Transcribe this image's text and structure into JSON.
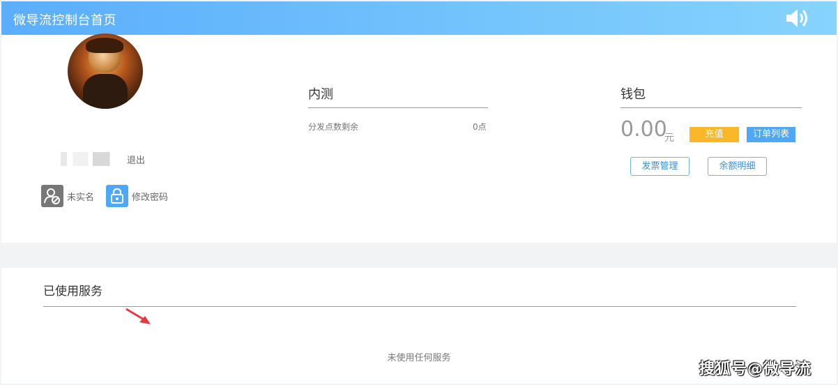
{
  "header": {
    "title": "微导流控制台首页",
    "icon": "speaker-icon"
  },
  "profile": {
    "logout": "退出",
    "realname_status": "未实名",
    "change_password": "修改密码"
  },
  "neice": {
    "title": "内测",
    "label": "分发点数剩余",
    "value": "0点"
  },
  "wallet": {
    "title": "钱包",
    "balance": "0.00",
    "unit": "元",
    "recharge": "充值",
    "orders": "订单列表",
    "invoice": "发票管理",
    "balance_detail": "余额明细"
  },
  "services": {
    "title": "已使用服务",
    "empty": "未使用任何服务"
  },
  "watermark": "搜狐号@微导流",
  "colors": {
    "header_start": "#5aaefc",
    "header_end": "#86d3fd",
    "recharge": "#fbb72a",
    "accent": "#4fa8f5"
  }
}
